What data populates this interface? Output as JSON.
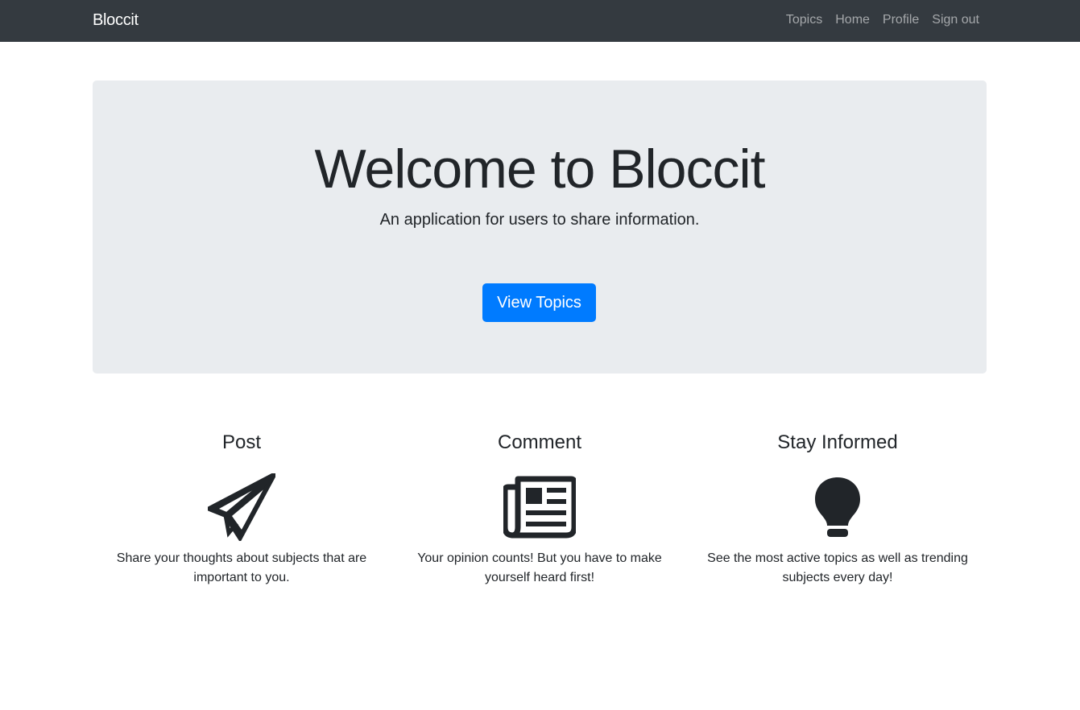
{
  "navbar": {
    "brand": "Bloccit",
    "links": [
      {
        "label": "Topics"
      },
      {
        "label": "Home"
      },
      {
        "label": "Profile"
      },
      {
        "label": "Sign out"
      }
    ]
  },
  "jumbotron": {
    "title": "Welcome to Bloccit",
    "lead": "An application for users to share information.",
    "button_label": "View Topics"
  },
  "features": [
    {
      "title": "Post",
      "icon": "paper-plane-icon",
      "text": "Share your thoughts about subjects that are important to you."
    },
    {
      "title": "Comment",
      "icon": "newspaper-icon",
      "text": "Your opinion counts! But you have to make yourself heard first!"
    },
    {
      "title": "Stay Informed",
      "icon": "lightbulb-icon",
      "text": "See the most active topics as well as trending subjects every day!"
    }
  ],
  "colors": {
    "navbar_bg": "#343a40",
    "jumbotron_bg": "#e9ecef",
    "primary": "#007bff",
    "text": "#212529"
  }
}
